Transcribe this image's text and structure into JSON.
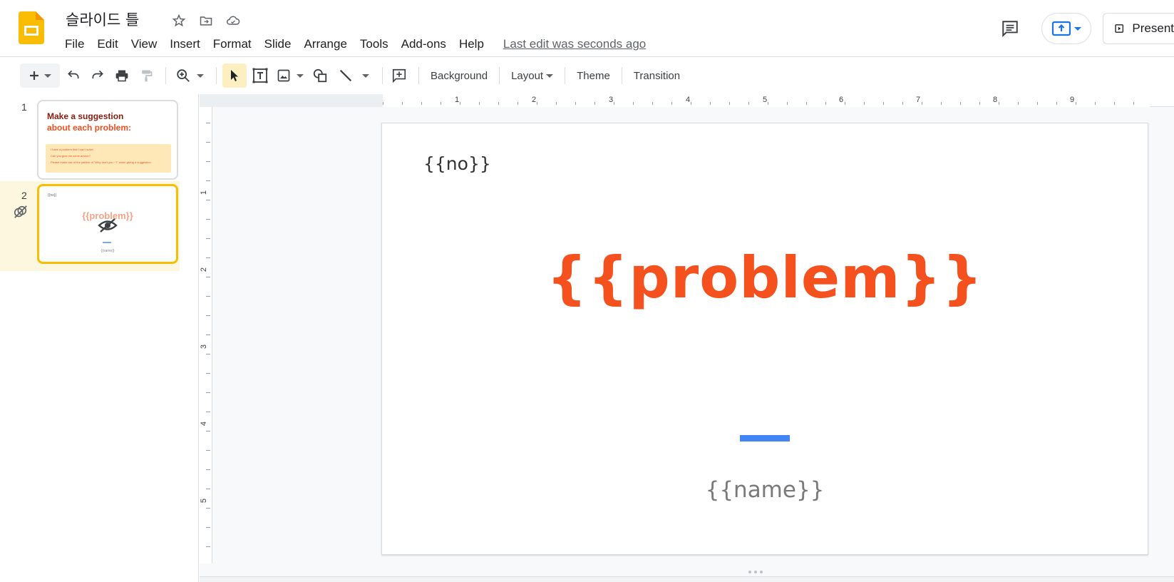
{
  "header": {
    "title": "슬라이드 틀",
    "menu": [
      "File",
      "Edit",
      "View",
      "Insert",
      "Format",
      "Slide",
      "Arrange",
      "Tools",
      "Add-ons",
      "Help"
    ],
    "last_edit": "Last edit was seconds ago",
    "present_label": "Present",
    "title_icons": [
      "star-icon",
      "move-to-folder-icon",
      "cloud-saved-icon"
    ]
  },
  "toolbar": {
    "background": "Background",
    "layout": "Layout",
    "theme": "Theme",
    "transition": "Transition"
  },
  "ruler": {
    "h_labels": [
      "1",
      "2",
      "3",
      "4",
      "5",
      "6",
      "7",
      "8",
      "9"
    ],
    "v_labels": [
      "1",
      "2",
      "3",
      "4",
      "5"
    ]
  },
  "filmstrip": {
    "slides": [
      {
        "number": "1",
        "title_line1": "Make a suggestion",
        "title_line2": "about each problem:",
        "lines": [
          "I have a problem that I can't solve.",
          "Can you give me some advice?",
          "Please make use of the pattern of \"Why don't you ~?\" when giving a suggestion."
        ]
      },
      {
        "number": "2",
        "no": "{{no}}",
        "problem": "{{problem}}",
        "name": "{{name}}"
      }
    ]
  },
  "slide": {
    "no": "{{no}}",
    "problem": "{{problem}}",
    "name": "{{name}}"
  },
  "colors": {
    "accent_orange": "#f4511e",
    "accent_blue": "#4285f4",
    "selection_yellow": "#fbbc04"
  }
}
